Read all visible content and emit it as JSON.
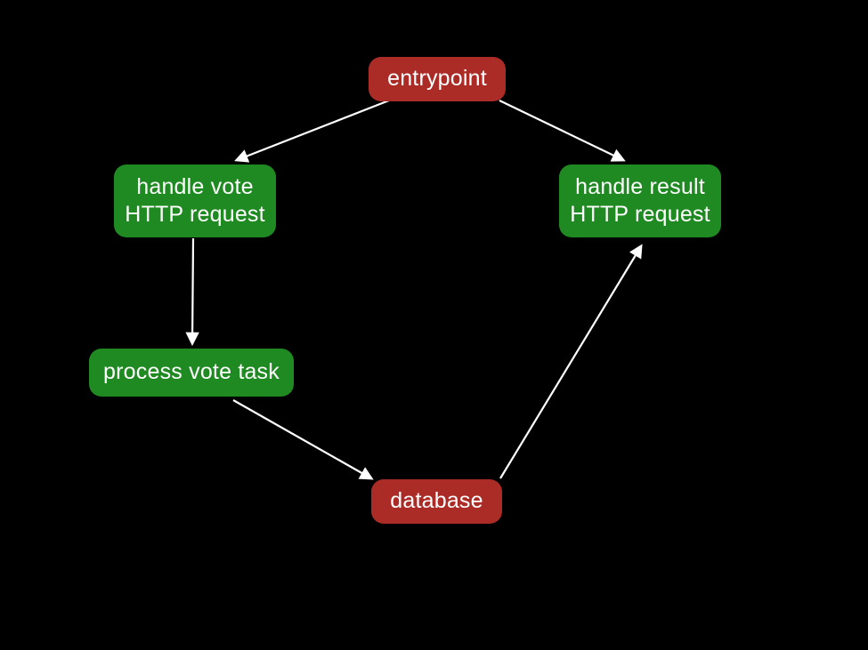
{
  "nodes": {
    "entrypoint": {
      "label": "entrypoint"
    },
    "handle_vote": {
      "label": "handle vote\nHTTP request"
    },
    "handle_result": {
      "label": "handle result\nHTTP request"
    },
    "process_vote": {
      "label": "process vote task"
    },
    "database": {
      "label": "database"
    }
  }
}
